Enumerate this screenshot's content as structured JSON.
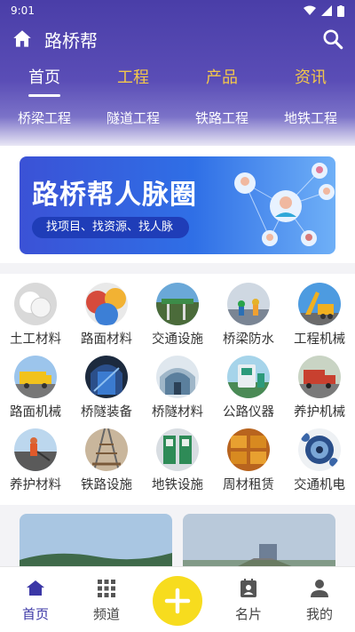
{
  "status": {
    "time": "9:01"
  },
  "app": {
    "title": "路桥帮"
  },
  "tabs": [
    {
      "label": "首页",
      "active": true
    },
    {
      "label": "工程",
      "active": false
    },
    {
      "label": "产品",
      "active": false
    },
    {
      "label": "资讯",
      "active": false
    }
  ],
  "subnav": [
    "桥梁工程",
    "隧道工程",
    "铁路工程",
    "地铁工程"
  ],
  "banner": {
    "title": "路桥帮人脉圈",
    "subtitle": "找项目、找资源、找人脉"
  },
  "categories": [
    {
      "label": "土工材料",
      "icon": "geotextile-icon"
    },
    {
      "label": "路面材料",
      "icon": "pavement-material-icon"
    },
    {
      "label": "交通设施",
      "icon": "traffic-facility-icon"
    },
    {
      "label": "桥梁防水",
      "icon": "bridge-waterproof-icon"
    },
    {
      "label": "工程机械",
      "icon": "construction-machinery-icon"
    },
    {
      "label": "路面机械",
      "icon": "road-machinery-icon"
    },
    {
      "label": "桥隧装备",
      "icon": "tunnel-equipment-icon"
    },
    {
      "label": "桥隧材料",
      "icon": "tunnel-material-icon"
    },
    {
      "label": "公路仪器",
      "icon": "highway-instrument-icon"
    },
    {
      "label": "养护机械",
      "icon": "maintenance-machinery-icon"
    },
    {
      "label": "养护材料",
      "icon": "maintenance-material-icon"
    },
    {
      "label": "铁路设施",
      "icon": "railway-facility-icon"
    },
    {
      "label": "地铁设施",
      "icon": "subway-facility-icon"
    },
    {
      "label": "周材租赁",
      "icon": "material-rental-icon"
    },
    {
      "label": "交通机电",
      "icon": "traffic-electromechanical-icon"
    }
  ],
  "bottom_nav": [
    {
      "label": "首页",
      "icon": "home-icon",
      "active": true
    },
    {
      "label": "频道",
      "icon": "grid-icon",
      "active": false
    },
    {
      "label": "",
      "icon": "plus-icon",
      "active": false
    },
    {
      "label": "名片",
      "icon": "card-icon",
      "active": false
    },
    {
      "label": "我的",
      "icon": "person-icon",
      "active": false
    }
  ],
  "colors": {
    "header": "#4a3ea8",
    "accent_tab": "#f4c84a",
    "fab": "#f7dc1e",
    "nav_active": "#3b37a6"
  }
}
